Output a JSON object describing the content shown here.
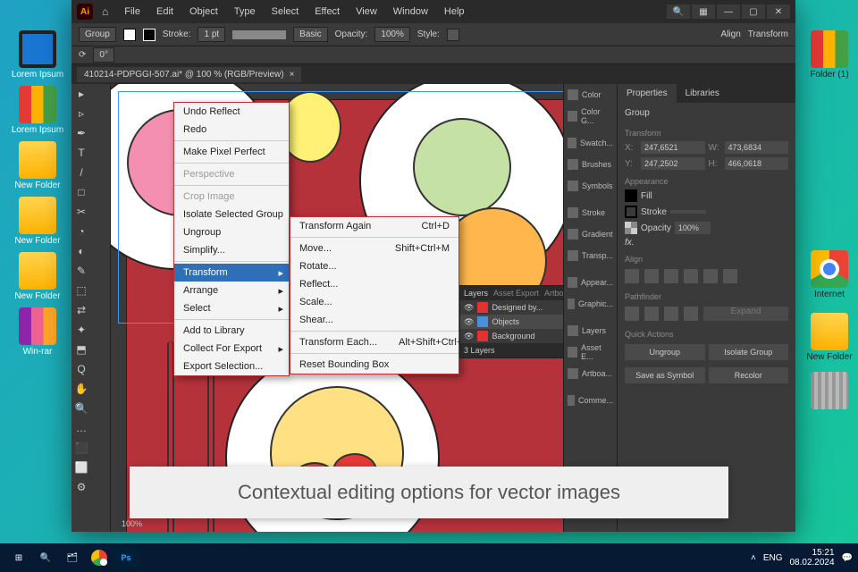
{
  "desktop": {
    "left_icons": [
      {
        "label": "Lorem Ipsum",
        "kind": "disk"
      },
      {
        "label": "Lorem Ipsum",
        "kind": "binder"
      },
      {
        "label": "New Folder",
        "kind": "folder"
      },
      {
        "label": "New Folder",
        "kind": "folder"
      },
      {
        "label": "New Folder",
        "kind": "folder"
      },
      {
        "label": "Win-rar",
        "kind": "rar"
      }
    ],
    "right_icons": [
      {
        "label": "Folder (1)",
        "kind": "binder"
      },
      {
        "label": "Internet",
        "kind": "chrome"
      },
      {
        "label": "New Folder",
        "kind": "folder"
      },
      {
        "label": "",
        "kind": "trash"
      }
    ]
  },
  "ai": {
    "menus": [
      "File",
      "Edit",
      "Object",
      "Type",
      "Select",
      "Effect",
      "View",
      "Window",
      "Help"
    ],
    "ctrl": {
      "target": "Group",
      "stroke_label": "Stroke:",
      "stroke_pt": "1 pt",
      "basic": "Basic",
      "opacity_label": "Opacity:",
      "opacity": "100%",
      "style_label": "Style:",
      "align": "Align",
      "transform": "Transform",
      "rotate": "0°"
    },
    "doc_tab": "410214-PDPGGI-507.ai* @ 100 % (RGB/Preview)",
    "tools": [
      "▸",
      "▹",
      "✒",
      "T",
      "/",
      "□",
      "✂",
      "◔",
      "◐",
      "✎",
      "⬚",
      "⇄",
      "✦",
      "⬒",
      "Q",
      "✋",
      "🔍",
      "…",
      "⬛",
      "⬜",
      "⚙"
    ],
    "context_menu": [
      {
        "label": "Undo Reflect"
      },
      {
        "label": "Redo"
      },
      {
        "sep": true
      },
      {
        "label": "Make Pixel Perfect"
      },
      {
        "sep": true
      },
      {
        "label": "Perspective",
        "disabled": true
      },
      {
        "sep": true
      },
      {
        "label": "Crop Image",
        "disabled": true
      },
      {
        "label": "Isolate Selected Group"
      },
      {
        "label": "Ungroup"
      },
      {
        "label": "Simplify..."
      },
      {
        "sep": true
      },
      {
        "label": "Transform",
        "sub": true,
        "hi": true
      },
      {
        "label": "Arrange",
        "sub": true
      },
      {
        "label": "Select",
        "sub": true
      },
      {
        "sep": true
      },
      {
        "label": "Add to Library"
      },
      {
        "label": "Collect For Export",
        "sub": true
      },
      {
        "label": "Export Selection..."
      }
    ],
    "transform_submenu": [
      {
        "label": "Transform Again",
        "short": "Ctrl+D"
      },
      {
        "sep": true
      },
      {
        "label": "Move...",
        "short": "Shift+Ctrl+M"
      },
      {
        "label": "Rotate..."
      },
      {
        "label": "Reflect..."
      },
      {
        "label": "Scale..."
      },
      {
        "label": "Shear..."
      },
      {
        "sep": true
      },
      {
        "label": "Transform Each...",
        "short": "Alt+Shift+Ctrl+D"
      },
      {
        "sep": true
      },
      {
        "label": "Reset Bounding Box"
      }
    ],
    "dock_items": [
      "Color",
      "Color G...",
      "Swatch...",
      "Brushes",
      "Symbols",
      "Stroke",
      "Gradient",
      "Transp...",
      "Appear...",
      "Graphic...",
      "Layers",
      "Asset E...",
      "Artboa...",
      "Comme..."
    ],
    "layers_panel": {
      "tabs": [
        "Layers",
        "Asset Export",
        "Artboards"
      ],
      "rows": [
        {
          "name": "Designed by...",
          "color": "#d33"
        },
        {
          "name": "Objects",
          "color": "#4a90d9",
          "sel": true
        },
        {
          "name": "Background",
          "color": "#d33"
        }
      ],
      "footer": "3 Layers"
    },
    "properties": {
      "tabs": [
        "Properties",
        "Libraries"
      ],
      "target": "Group",
      "section_transform": "Transform",
      "X": "247,6521",
      "W": "473,6834",
      "Y": "247,2502",
      "H": "466,0618",
      "section_appearance": "Appearance",
      "fill": "Fill",
      "stroke": "Stroke",
      "stroke_val": "",
      "opacity_label": "Opacity",
      "opacity": "100%",
      "fx": "fx.",
      "section_align": "Align",
      "section_pf": "Pathfinder",
      "expand": "Expand",
      "section_qa": "Quick Actions",
      "qa": [
        "Ungroup",
        "Isolate Group",
        "Save as Symbol",
        "Recolor"
      ]
    },
    "zoom": "100%"
  },
  "caption": "Contextual editing options for vector images",
  "taskbar": {
    "lang": "ENG",
    "time": "15:21",
    "date": "08.02.2024"
  }
}
